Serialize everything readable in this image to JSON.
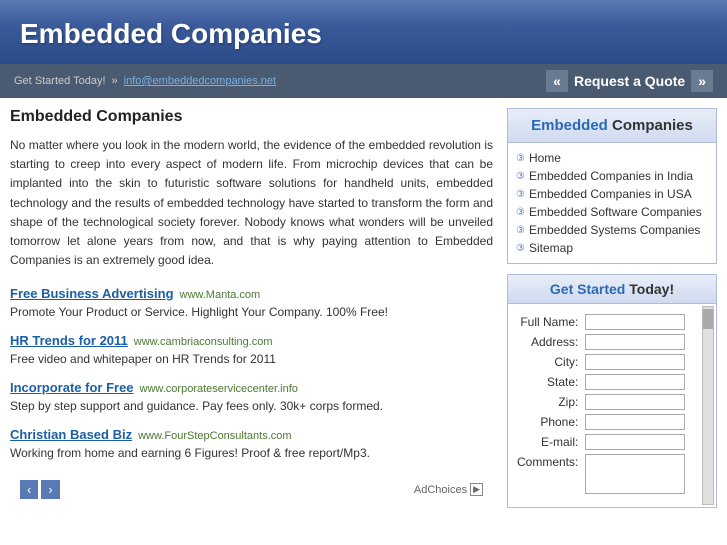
{
  "header": {
    "title": "Embedded Companies"
  },
  "toolbar": {
    "get_started_label": "Get Started Today!",
    "email_label": "info@embeddedcompanies.net",
    "email_href": "mailto:info@embeddedcompanies.net",
    "chevron_left": "«",
    "request_quote": "Request a Quote",
    "chevron_right": "»"
  },
  "main": {
    "page_title": "Embedded Companies",
    "intro": "No matter where you look in the modern world, the evidence of the embedded revolution is starting to creep into every aspect of modern life. From microchip devices that can be implanted into the skin to futuristic software solutions for handheld units, embedded technology and the results of embedded technology have started to transform the form and shape of the technological society forever. Nobody knows what wonders will be unveiled tomorrow let alone years from now, and that is why paying attention to Embedded Companies is an extremely good idea."
  },
  "ads": [
    {
      "title": "Free Business Advertising",
      "source": "www.Manta.com",
      "description": "Promote Your Product or Service. Highlight Your Company. 100% Free!"
    },
    {
      "title": "HR Trends for 2011",
      "source": "www.cambriaconsulting.com",
      "description": "Free video and whitepaper on HR Trends for 2011"
    },
    {
      "title": "Incorporate for Free",
      "source": "www.corporateservicecenter.info",
      "description": "Step by step support and guidance. Pay fees only. 30k+ corps formed."
    },
    {
      "title": "Christian Based Biz",
      "source": "www.FourStepConsultants.com",
      "description": "Working from home and earning 6 Figures! Proof & free report/Mp3."
    }
  ],
  "bottom": {
    "adchoices": "AdChoices"
  },
  "sidebar": {
    "brand_em": "Embedded",
    "brand_rest": " Companies",
    "nav_items": [
      {
        "label": "Home"
      },
      {
        "label": "Embedded Companies in India"
      },
      {
        "label": "Embedded Companies in USA"
      },
      {
        "label": "Embedded Software Companies"
      },
      {
        "label": "Embedded Systems Companies"
      },
      {
        "label": "Sitemap"
      }
    ],
    "form_header_em": "Get Started",
    "form_header_rest": " Today!",
    "form_fields": [
      {
        "label": "Full Name:",
        "type": "text"
      },
      {
        "label": "Address:",
        "type": "text"
      },
      {
        "label": "City:",
        "type": "text"
      },
      {
        "label": "State:",
        "type": "text"
      },
      {
        "label": "Zip:",
        "type": "text"
      },
      {
        "label": "Phone:",
        "type": "text"
      },
      {
        "label": "E-mail:",
        "type": "text"
      },
      {
        "label": "Comments:",
        "type": "textarea"
      }
    ]
  }
}
